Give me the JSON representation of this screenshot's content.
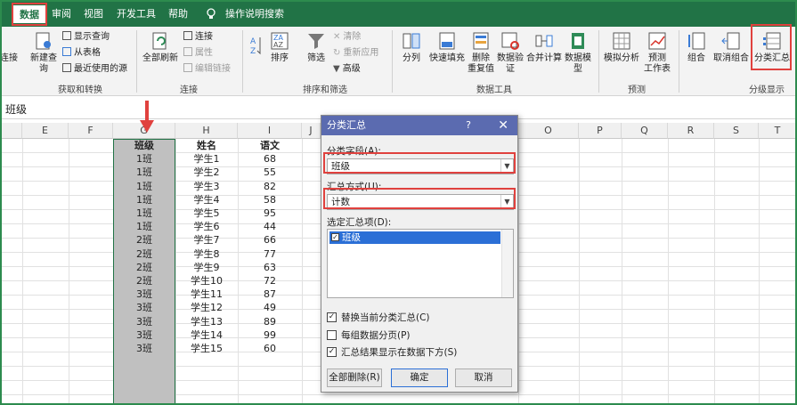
{
  "tabs": [
    {
      "label": "数据",
      "active": true
    },
    {
      "label": "审阅",
      "active": false
    },
    {
      "label": "视图",
      "active": false
    },
    {
      "label": "开发工具",
      "active": false
    },
    {
      "label": "帮助",
      "active": false
    }
  ],
  "search": {
    "label": "操作说明搜索",
    "icon": "lightbulb-icon"
  },
  "ribbon": {
    "get_transform": {
      "partial_left": "连接",
      "new_query": "新建查\n询",
      "show_query": "显示查询",
      "from_table": "从表格",
      "recent_sources": "最近使用的源",
      "group": "获取和转换"
    },
    "connections": {
      "refresh_all": "全部刷新",
      "connections": "连接",
      "properties": "属性",
      "edit_links": "编辑链接",
      "group": "连接"
    },
    "sort_filter": {
      "sort": "排序",
      "filter": "筛选",
      "clear": "清除",
      "reapply": "重新应用",
      "advanced": "高级",
      "group": "排序和筛选"
    },
    "data_tools": {
      "split": "分列",
      "flash_fill": "快速填充",
      "remove_dup": "删除\n重复值",
      "validation": "数据验\n证",
      "consolidate": "合并计算",
      "data_model": "数据模\n型",
      "group": "数据工具"
    },
    "forecast": {
      "what_if": "模拟分析",
      "forecast_sheet": "预测\n工作表",
      "group": "预测"
    },
    "outline": {
      "group_btn": "组合",
      "ungroup": "取消组合",
      "subtotal": "分类汇总",
      "group": "分级显示"
    }
  },
  "formula_bar": {
    "value": "班级"
  },
  "columns": [
    "E",
    "F",
    "G",
    "H",
    "I",
    "J",
    "O",
    "P",
    "Q",
    "R",
    "S",
    "T"
  ],
  "table": {
    "headers": [
      "班级",
      "姓名",
      "语文"
    ],
    "rows": [
      [
        "1班",
        "学生1",
        "68"
      ],
      [
        "1班",
        "学生2",
        "55"
      ],
      [
        "1班",
        "学生3",
        "82"
      ],
      [
        "1班",
        "学生4",
        "58"
      ],
      [
        "1班",
        "学生5",
        "95"
      ],
      [
        "1班",
        "学生6",
        "44"
      ],
      [
        "2班",
        "学生7",
        "66"
      ],
      [
        "2班",
        "学生8",
        "77"
      ],
      [
        "2班",
        "学生9",
        "63"
      ],
      [
        "2班",
        "学生10",
        "72"
      ],
      [
        "3班",
        "学生11",
        "87"
      ],
      [
        "3班",
        "学生12",
        "49"
      ],
      [
        "3班",
        "学生13",
        "89"
      ],
      [
        "3班",
        "学生14",
        "99"
      ],
      [
        "3班",
        "学生15",
        "60"
      ]
    ]
  },
  "dialog": {
    "title": "分类汇总",
    "help": "?",
    "close": "✕",
    "field_label": "分类字段(A):",
    "field_value": "班级",
    "method_label": "汇总方式(U):",
    "method_value": "计数",
    "items_label": "选定汇总项(D):",
    "items": [
      {
        "label": "班级",
        "checked": true
      }
    ],
    "check_replace": "替换当前分类汇总(C)",
    "check_pagebreak": "每组数据分页(P)",
    "check_below": "汇总结果显示在数据下方(S)",
    "btn_remove_all": "全部删除(R)",
    "btn_ok": "确定",
    "btn_cancel": "取消"
  },
  "colors": {
    "accent": "#217346",
    "highlight": "#e0413e",
    "dialog_title": "#5b6bb0"
  }
}
